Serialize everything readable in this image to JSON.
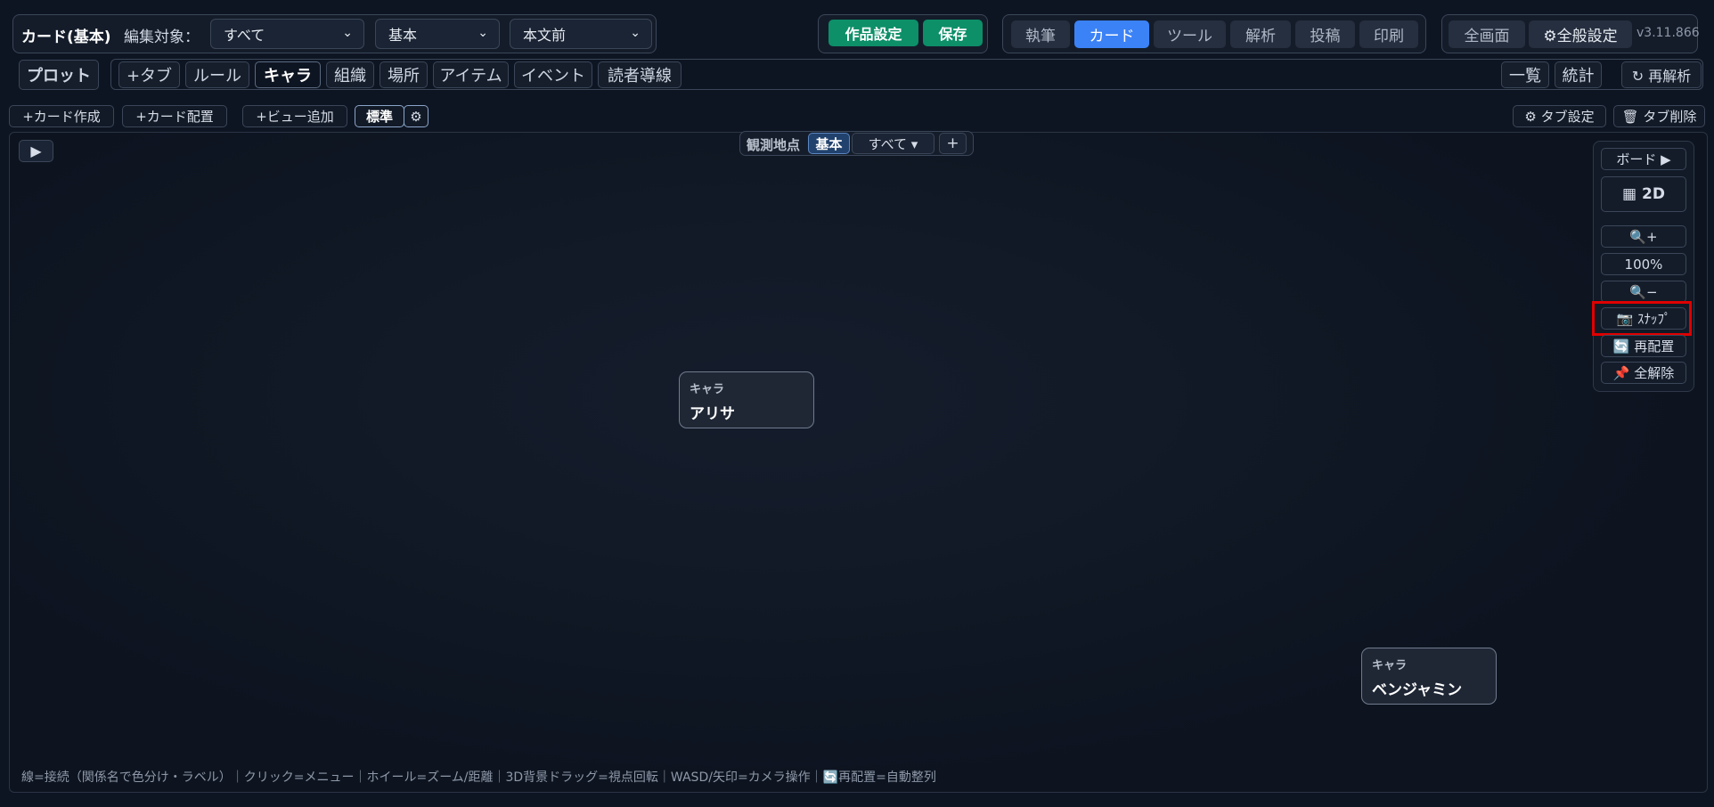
{
  "header": {
    "title": "カード(基本)",
    "edit_target_label": "編集対象：",
    "selects": [
      "すべて",
      "基本",
      "本文前"
    ],
    "work_settings": "作品設定",
    "save": "保存",
    "modes": [
      "執筆",
      "カード",
      "ツール",
      "解析",
      "投稿",
      "印刷"
    ],
    "active_mode": "カード",
    "fullscreen": "全画面",
    "general_settings": "⚙全般設定",
    "version": "v3.11.866"
  },
  "tabs": {
    "plot": "プロット",
    "add_tab": "+タブ",
    "items": [
      "ルール",
      "キャラ",
      "組織",
      "場所",
      "アイテム",
      "イベント",
      "読者導線"
    ],
    "active": "キャラ",
    "list": "一覧",
    "stats": "統計",
    "reanalyze": "↻ 再解析"
  },
  "toolbar": {
    "create_card": "+カード作成",
    "place_card": "+カード配置",
    "add_view": "+ビュー追加",
    "standard": "標準",
    "gear": "⚙",
    "tab_settings": "⚙ タブ設定",
    "delete_tab": "🗑 タブ削除"
  },
  "viewpoint": {
    "label": "観測地点",
    "basic": "基本",
    "all": "すべて ▾",
    "add": "+"
  },
  "canvas": {
    "play": "▶",
    "cards": [
      {
        "type": "キャラ",
        "name": "アリサ"
      },
      {
        "type": "キャラ",
        "name": "ベンジャミン"
      }
    ]
  },
  "panel": {
    "board": "ボード ▶",
    "mode_2d": "▦ 2D",
    "zoom_in": "🔍+",
    "zoom_level": "100%",
    "zoom_out": "🔍−",
    "snap": "📷 ｽﾅｯﾌﾟ",
    "rearrange": "🔄 再配置",
    "clear_all": "📌 全解除"
  },
  "footer": {
    "help": "線=接続（関係名で色分け・ラベル）｜クリック=メニュー｜ホイール=ズーム/距離｜3D背景ドラッグ=視点回転｜WASD/矢印=カメラ操作｜🔄再配置=自動整列"
  },
  "colors": {
    "accent": "#3b82f6",
    "save_green": "#0d8f68",
    "background": "#0e1522",
    "highlight": "#e00000"
  }
}
